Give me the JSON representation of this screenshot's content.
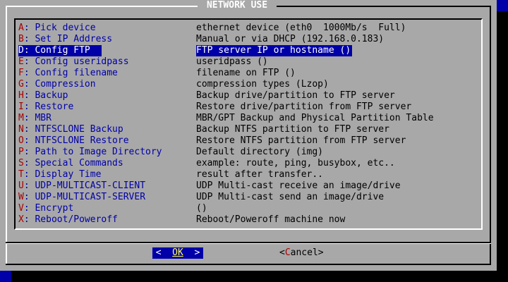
{
  "dialog": {
    "title": "NETWORK USE",
    "items": [
      {
        "key": "A",
        "rest": ": Pick device",
        "desc": "ethernet device (eth0  1000Mb/s  Full)",
        "selected": false
      },
      {
        "key": "B",
        "rest": ": Set IP Address",
        "desc": "Manual or via DHCP (192.168.0.183)",
        "selected": false
      },
      {
        "key": "D",
        "rest": ": Config FTP",
        "desc": "FTP server IP or hostname ()",
        "selected": true
      },
      {
        "key": "E",
        "rest": ": Config useridpass",
        "desc": "useridpass ()",
        "selected": false
      },
      {
        "key": "F",
        "rest": ": Config filename",
        "desc": "filename on FTP ()",
        "selected": false
      },
      {
        "key": "G",
        "rest": ": Compression",
        "desc": "compression types (Lzop)",
        "selected": false
      },
      {
        "key": "H",
        "rest": ": Backup",
        "desc": "Backup drive/partition to FTP server",
        "selected": false
      },
      {
        "key": "I",
        "rest": ": Restore",
        "desc": "Restore drive/partition from FTP server",
        "selected": false
      },
      {
        "key": "M",
        "rest": ": MBR",
        "desc": "MBR/GPT Backup and Physical Partition Table",
        "selected": false
      },
      {
        "key": "N",
        "rest": ": NTFSCLONE Backup",
        "desc": "Backup NTFS partition to FTP server",
        "selected": false
      },
      {
        "key": "O",
        "rest": ": NTFSCLONE Restore",
        "desc": "Restore NTFS partition from FTP server",
        "selected": false
      },
      {
        "key": "P",
        "rest": ": Path to Image Directory",
        "desc": "Default directory (img)",
        "selected": false
      },
      {
        "key": "S",
        "rest": ": Special Commands",
        "desc": "example: route, ping, busybox, etc..",
        "selected": false
      },
      {
        "key": "T",
        "rest": ": Display Time",
        "desc": "result after transfer..",
        "selected": false
      },
      {
        "key": "U",
        "rest": ": UDP-MULTICAST-CLIENT",
        "desc": "UDP Multi-cast receive an image/drive",
        "selected": false
      },
      {
        "key": "W",
        "rest": ": UDP-MULTICAST-SERVER",
        "desc": "UDP Multi-cast send an image/drive",
        "selected": false
      },
      {
        "key": "V",
        "rest": ": Encrypt",
        "desc": "()",
        "selected": false
      },
      {
        "key": "X",
        "rest": ": Reboot/Poweroff",
        "desc": "Reboot/Poweroff machine now",
        "selected": false
      }
    ],
    "buttons": {
      "ok": {
        "left": "<  ",
        "hot": "OK",
        "right": "  >"
      },
      "cancel": {
        "left": "<",
        "hot": "C",
        "right": "ancel>"
      }
    }
  },
  "colors": {
    "background": "#0000a8",
    "dialog": "#a8a8a8",
    "tag_text": "#0000a8",
    "hotkey": "#a80000",
    "selected_bg": "#0000a8",
    "selected_text": "#ffffff",
    "ok_hotkey": "#ffff54"
  }
}
